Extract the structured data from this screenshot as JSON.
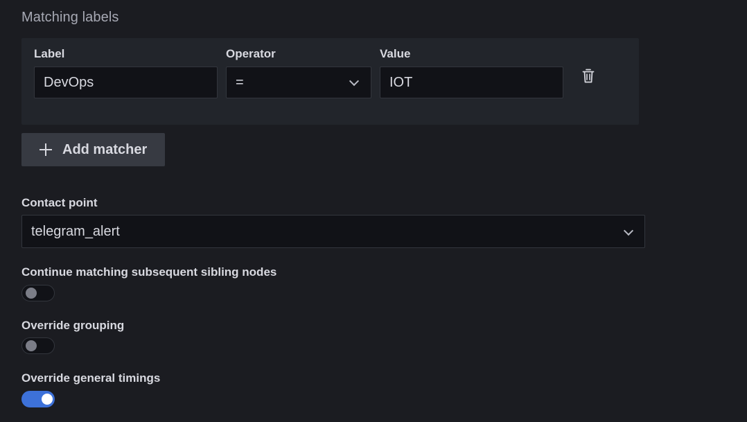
{
  "section": {
    "title": "Matching labels"
  },
  "matcher": {
    "label_header": "Label",
    "operator_header": "Operator",
    "value_header": "Value",
    "label_value": "DevOps",
    "operator_value": "=",
    "value_value": "IOT"
  },
  "add_matcher": {
    "label": "Add matcher",
    "icon": "plus-icon"
  },
  "contact_point": {
    "label": "Contact point",
    "selected": "telegram_alert"
  },
  "toggles": [
    {
      "label": "Continue matching subsequent sibling nodes",
      "enabled": false
    },
    {
      "label": "Override grouping",
      "enabled": false
    },
    {
      "label": "Override general timings",
      "enabled": true
    }
  ],
  "colors": {
    "background": "#1b1c21",
    "panel": "#22252b",
    "input": "#111217",
    "accent": "#3d71d9"
  }
}
